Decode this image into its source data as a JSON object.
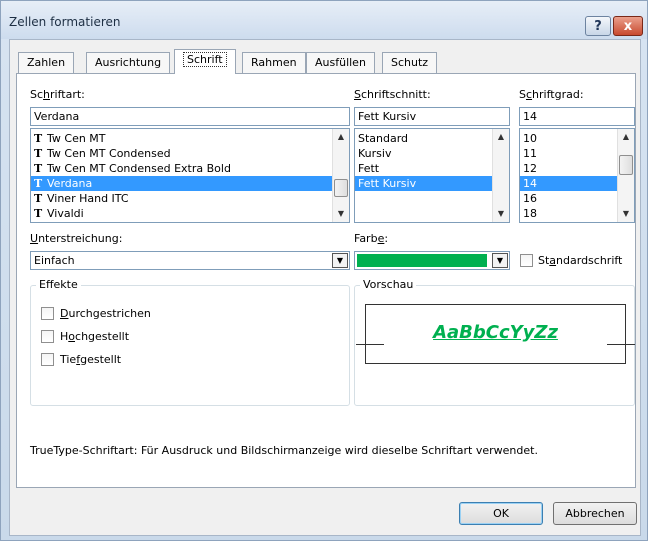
{
  "window": {
    "title": "Zellen formatieren",
    "help_label": "?",
    "close_label": "x"
  },
  "tabs": [
    {
      "label": "Zahlen"
    },
    {
      "label": "Ausrichtung"
    },
    {
      "label": "Schrift"
    },
    {
      "label": "Rahmen"
    },
    {
      "label": "Ausfüllen"
    },
    {
      "label": "Schutz"
    }
  ],
  "font": {
    "label_pre": "Sc",
    "label_u": "h",
    "label_post": "riftart:",
    "value": "Verdana",
    "items": [
      "Tw Cen MT",
      "Tw Cen MT Condensed",
      "Tw Cen MT Condensed Extra Bold",
      "Verdana",
      "Viner Hand ITC",
      "Vivaldi"
    ],
    "selected_index": 3,
    "icon_glyph": "T"
  },
  "style": {
    "label_pre": "",
    "label_u": "S",
    "label_post": "chriftschnitt:",
    "value": "Fett Kursiv",
    "items": [
      "Standard",
      "Kursiv",
      "Fett",
      "Fett Kursiv"
    ],
    "selected_index": 3
  },
  "size": {
    "label_pre": "S",
    "label_u": "c",
    "label_post": "hriftgrad:",
    "value": "14",
    "items": [
      "10",
      "11",
      "12",
      "14",
      "16",
      "18"
    ],
    "selected_index": 3
  },
  "underline": {
    "label_pre": "",
    "label_u": "U",
    "label_post": "nterstreichung:",
    "value": "Einfach"
  },
  "color": {
    "label_pre": "Farb",
    "label_u": "e",
    "label_post": ":",
    "swatch": "#00b050"
  },
  "standard_font": {
    "label_pre": "St",
    "label_u": "a",
    "label_post": "ndardschrift",
    "checked": false
  },
  "effects": {
    "title": "Effekte",
    "items": [
      {
        "pre": "",
        "u": "D",
        "post": "urchgestrichen",
        "checked": false
      },
      {
        "pre": "H",
        "u": "o",
        "post": "chgestellt",
        "checked": false
      },
      {
        "pre": "Tie",
        "u": "f",
        "post": "gestellt",
        "checked": false
      }
    ]
  },
  "preview": {
    "title": "Vorschau",
    "sample": "AaBbCcYyZz",
    "color": "#00b050"
  },
  "info_text": "TrueType-Schriftart: Für Ausdruck und Bildschirmanzeige wird dieselbe Schriftart verwendet.",
  "buttons": {
    "ok": "OK",
    "cancel": "Abbrechen"
  }
}
